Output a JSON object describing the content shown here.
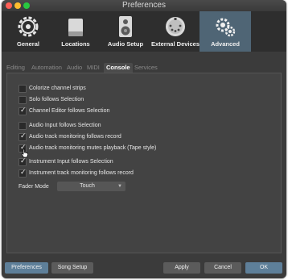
{
  "window": {
    "title": "Preferences"
  },
  "colors": {
    "accent": "#4f6575",
    "close": "#ff5f57",
    "minimize": "#febc2e",
    "zoom": "#28c840",
    "bottom_accent": "#5e7f99"
  },
  "toolbar": [
    {
      "label": "General",
      "icon": "gear-icon"
    },
    {
      "label": "Locations",
      "icon": "drive-icon"
    },
    {
      "label": "Audio Setup",
      "icon": "speaker-icon"
    },
    {
      "label": "External Devices",
      "icon": "midi-connector-icon"
    },
    {
      "label": "Advanced",
      "icon": "gears-icon",
      "active": true
    }
  ],
  "tabs": [
    {
      "label": "Editing"
    },
    {
      "label": "Automation"
    },
    {
      "label": "Audio"
    },
    {
      "label": "MIDI"
    },
    {
      "label": "Console",
      "active": true
    },
    {
      "label": "Services"
    }
  ],
  "options": [
    {
      "label": "Colorize channel strips",
      "checked": false
    },
    {
      "label": "Solo follows Selection",
      "checked": false
    },
    {
      "label": "Channel Editor follows Selection",
      "checked": true
    },
    {
      "label": "Audio Input follows Selection",
      "checked": false
    },
    {
      "label": "Audio track monitoring follows record",
      "checked": true
    },
    {
      "label": "Audio track monitoring mutes playback (Tape style)",
      "checked": true
    },
    {
      "label": "Instrument Input follows Selection",
      "checked": true
    },
    {
      "label": "Instrument track monitoring follows record",
      "checked": true
    }
  ],
  "fader_mode": {
    "label": "Fader Mode",
    "value": "Touch"
  },
  "buttons": {
    "preferences": "Preferences",
    "song_setup": "Song Setup",
    "apply": "Apply",
    "cancel": "Cancel",
    "ok": "OK"
  }
}
